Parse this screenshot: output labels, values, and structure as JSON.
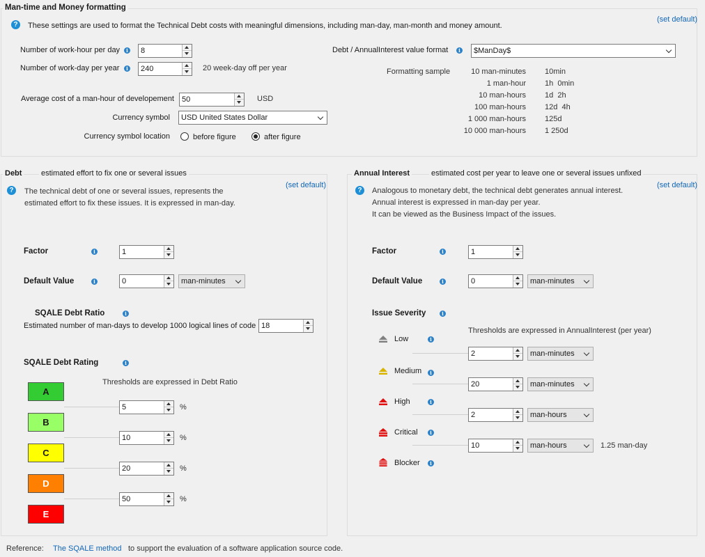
{
  "money": {
    "title": "Man-time and Money formatting",
    "description": "These settings are used to format the Technical Debt costs with meaningful dimensions, including man-day, man-month and money amount.",
    "set_default": "(set default)",
    "work_hour_label": "Number of work-hour per day",
    "work_hour_value": "8",
    "work_day_label": "Number of work-day per year",
    "work_day_value": "240",
    "work_day_note": "20 week-day off per year",
    "cost_label": "Average cost of a man-hour of developement",
    "cost_value": "50",
    "cost_unit": "USD",
    "currency_label": "Currency symbol",
    "currency_value": "USD United States Dollar",
    "location_label": "Currency symbol location",
    "location_before": "before figure",
    "location_after": "after figure",
    "location_selected": "after figure",
    "format_label": "Debt / AnnualInterest value format",
    "format_value": "$ManDay$",
    "sample_label": "Formatting sample",
    "samples": [
      {
        "input": "10 man-minutes",
        "output": "10min"
      },
      {
        "input": "1 man-hour",
        "output": "1h  0min"
      },
      {
        "input": "10 man-hours",
        "output": "1d  2h"
      },
      {
        "input": "100 man-hours",
        "output": "12d  4h"
      },
      {
        "input": "1 000 man-hours",
        "output": "125d"
      },
      {
        "input": "10 000 man-hours",
        "output": "1 250d"
      }
    ]
  },
  "debt": {
    "title": "Debt",
    "subtitle": "estimated effort to fix one or several issues",
    "set_default": "(set default)",
    "description_1": "The technical debt of one or several issues, represents the",
    "description_2": "estimated effort to fix these issues. It is expressed in man-day.",
    "factor_label": "Factor",
    "factor_value": "1",
    "default_label": "Default Value",
    "default_value": "0",
    "default_unit": "man-minutes",
    "ratio_label": "SQALE Debt Ratio",
    "ratio_desc": "Estimated number of man-days to develop 1000 logical lines of code",
    "ratio_value": "18",
    "rating_label": "SQALE Debt Rating",
    "rating_thresholds_note": "Thresholds are expressed in Debt Ratio",
    "ratings": [
      {
        "letter": "A",
        "color": "#33cc33"
      },
      {
        "letter": "B",
        "color": "#99ff66"
      },
      {
        "letter": "C",
        "color": "#ffff00"
      },
      {
        "letter": "D",
        "color": "#ff8000"
      },
      {
        "letter": "E",
        "color": "#ff0000"
      }
    ],
    "thresholds": [
      {
        "value": "5",
        "unit": "%"
      },
      {
        "value": "10",
        "unit": "%"
      },
      {
        "value": "20",
        "unit": "%"
      },
      {
        "value": "50",
        "unit": "%"
      }
    ]
  },
  "interest": {
    "title": "Annual Interest",
    "subtitle": "estimated cost per year to leave one or several issues unfixed",
    "set_default": "(set default)",
    "description_1": "Analogous to monetary debt, the technical debt generates annual interest.",
    "description_2": "Annual interest is expressed in man-day per year.",
    "description_3": "It can be viewed as the Business Impact of the issues.",
    "factor_label": "Factor",
    "factor_value": "1",
    "default_label": "Default Value",
    "default_value": "0",
    "default_unit": "man-minutes",
    "severity_label": "Issue Severity",
    "thresholds_note": "Thresholds are expressed in AnnualInterest (per year)",
    "severities": [
      {
        "name": "Low",
        "color": "#808080"
      },
      {
        "name": "Medium",
        "color": "#d8b400"
      },
      {
        "name": "High",
        "color": "#e01010"
      },
      {
        "name": "Critical",
        "color": "#e01010"
      },
      {
        "name": "Blocker",
        "color": "#e01010"
      }
    ],
    "thresholds": [
      {
        "value": "2",
        "unit": "man-minutes",
        "note": ""
      },
      {
        "value": "20",
        "unit": "man-minutes",
        "note": ""
      },
      {
        "value": "2",
        "unit": "man-hours",
        "note": ""
      },
      {
        "value": "10",
        "unit": "man-hours",
        "note": "1.25 man-day"
      }
    ]
  },
  "footer": {
    "reference_label": "Reference:",
    "link": "The SQALE method",
    "text": "to support the evaluation of a software application source code."
  }
}
